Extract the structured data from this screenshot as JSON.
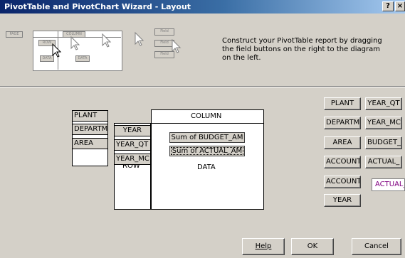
{
  "window": {
    "title": "PivotTable and PivotChart Wizard - Layout",
    "help_glyph": "?",
    "close_glyph": "×"
  },
  "illustration": {
    "btn1": "PAGE",
    "btn2": "ROW",
    "btn3": "COLUMN",
    "btn4": "DATA",
    "right1": "Field",
    "right2": "Field",
    "right3": "Field"
  },
  "instructions": "Construct your PivotTable report by dragging the field buttons on the right to the diagram on the left.",
  "layout": {
    "page_fields": [
      "PLANT",
      "DEPARTM",
      "AREA"
    ],
    "row_fields": [
      "YEAR",
      "YEAR_QT",
      "YEAR_MC"
    ],
    "row_label": "ROW",
    "column_label": "COLUMN",
    "data_label": "DATA",
    "data_fields": [
      "Sum of BUDGET_AM",
      "Sum of ACTUAL_AM"
    ]
  },
  "available_fields": [
    "PLANT",
    "YEAR_QT",
    "DEPARTM",
    "YEAR_MC",
    "AREA",
    "BUDGET_",
    "ACCOUNT",
    "ACTUAL_",
    "ACCOUNT",
    "YEAR"
  ],
  "dragged_field": "ACTUAL_",
  "buttons": {
    "help": "Help",
    "ok": "OK",
    "cancel": "Cancel"
  }
}
